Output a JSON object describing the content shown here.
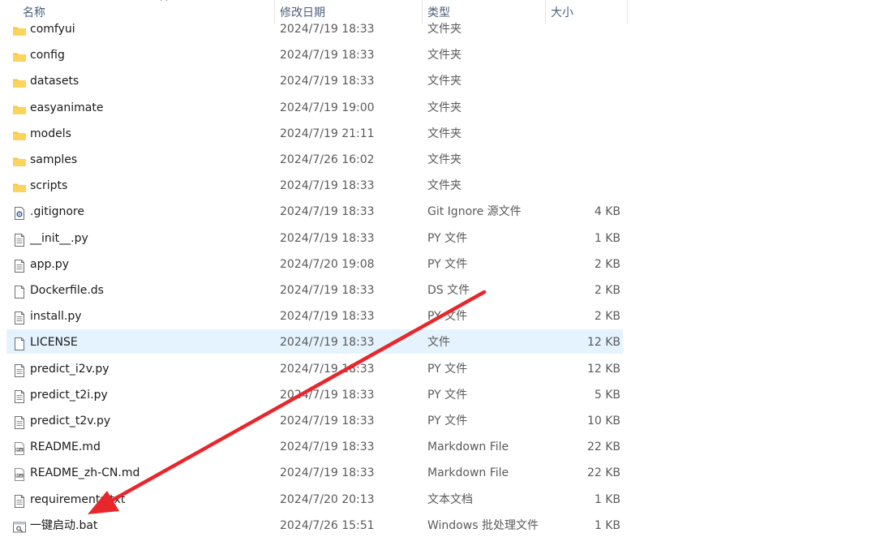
{
  "columns": {
    "name": "名称",
    "date": "修改日期",
    "type": "类型",
    "size": "大小"
  },
  "files": [
    {
      "name": "comfyui",
      "date": "2024/7/19 18:33",
      "type": "文件夹",
      "size": "",
      "icon": "folder-icon"
    },
    {
      "name": "config",
      "date": "2024/7/19 18:33",
      "type": "文件夹",
      "size": "",
      "icon": "folder-icon"
    },
    {
      "name": "datasets",
      "date": "2024/7/19 18:33",
      "type": "文件夹",
      "size": "",
      "icon": "folder-icon"
    },
    {
      "name": "easyanimate",
      "date": "2024/7/19 19:00",
      "type": "文件夹",
      "size": "",
      "icon": "folder-icon"
    },
    {
      "name": "models",
      "date": "2024/7/19 21:11",
      "type": "文件夹",
      "size": "",
      "icon": "folder-icon"
    },
    {
      "name": "samples",
      "date": "2024/7/26 16:02",
      "type": "文件夹",
      "size": "",
      "icon": "folder-icon"
    },
    {
      "name": "scripts",
      "date": "2024/7/19 18:33",
      "type": "文件夹",
      "size": "",
      "icon": "folder-icon"
    },
    {
      "name": ".gitignore",
      "date": "2024/7/19 18:33",
      "type": "Git Ignore 源文件",
      "size": "4 KB",
      "icon": "gear-file-icon"
    },
    {
      "name": "__init__.py",
      "date": "2024/7/19 18:33",
      "type": "PY 文件",
      "size": "1 KB",
      "icon": "text-file-icon"
    },
    {
      "name": "app.py",
      "date": "2024/7/20 19:08",
      "type": "PY 文件",
      "size": "2 KB",
      "icon": "text-file-icon"
    },
    {
      "name": "Dockerfile.ds",
      "date": "2024/7/19 18:33",
      "type": "DS 文件",
      "size": "2 KB",
      "icon": "blank-file-icon"
    },
    {
      "name": "install.py",
      "date": "2024/7/19 18:33",
      "type": "PY 文件",
      "size": "2 KB",
      "icon": "text-file-icon"
    },
    {
      "name": "LICENSE",
      "date": "2024/7/19 18:33",
      "type": "文件",
      "size": "12 KB",
      "icon": "blank-file-icon",
      "selected": true
    },
    {
      "name": "predict_i2v.py",
      "date": "2024/7/19 18:33",
      "type": "PY 文件",
      "size": "12 KB",
      "icon": "text-file-icon"
    },
    {
      "name": "predict_t2i.py",
      "date": "2024/7/19 18:33",
      "type": "PY 文件",
      "size": "5 KB",
      "icon": "text-file-icon"
    },
    {
      "name": "predict_t2v.py",
      "date": "2024/7/19 18:33",
      "type": "PY 文件",
      "size": "10 KB",
      "icon": "text-file-icon"
    },
    {
      "name": "README.md",
      "date": "2024/7/19 18:33",
      "type": "Markdown File",
      "size": "22 KB",
      "icon": "markdown-file-icon"
    },
    {
      "name": "README_zh-CN.md",
      "date": "2024/7/19 18:33",
      "type": "Markdown File",
      "size": "22 KB",
      "icon": "markdown-file-icon"
    },
    {
      "name": "requirements.txt",
      "date": "2024/7/20 20:13",
      "type": "文本文档",
      "size": "1 KB",
      "icon": "text-file-icon"
    },
    {
      "name": "一键启动.bat",
      "date": "2024/7/26 15:51",
      "type": "Windows 批处理文件",
      "size": "1 KB",
      "icon": "batch-file-icon"
    }
  ],
  "colors": {
    "selected_row": "#e5f3ff",
    "folder": "#f8c440",
    "arrow": "#e8262b"
  }
}
